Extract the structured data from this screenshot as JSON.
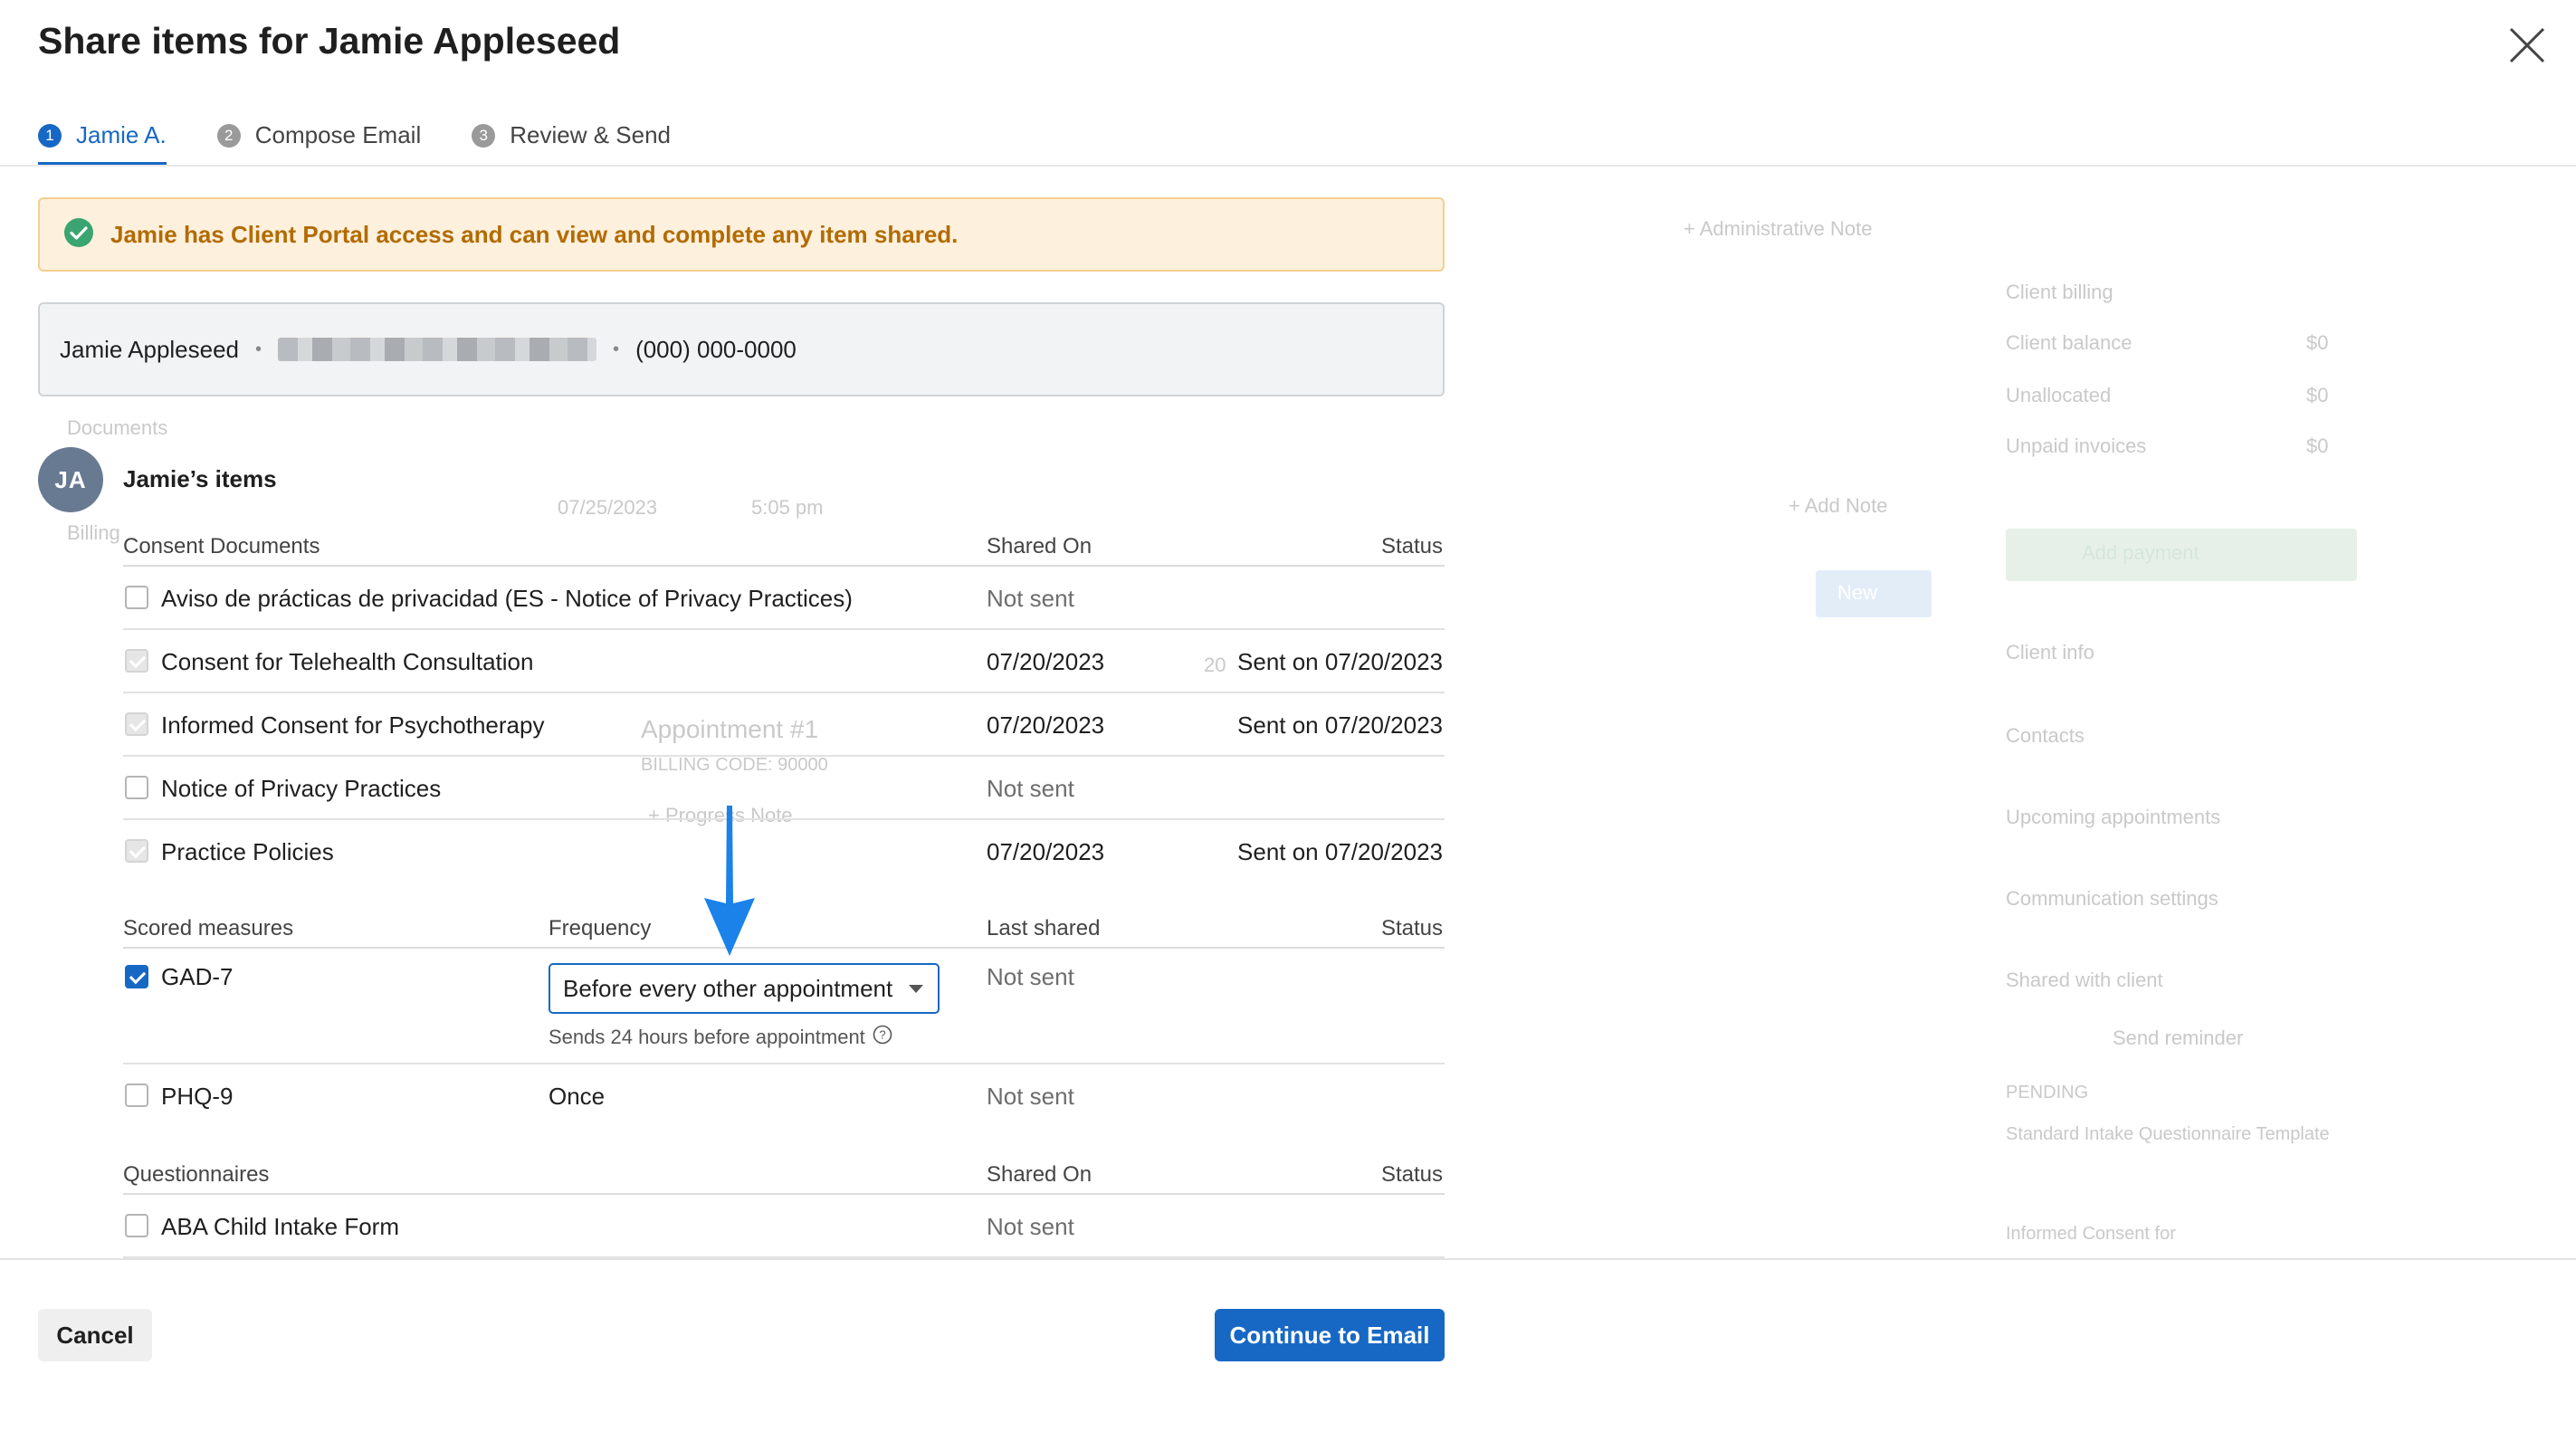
{
  "modal": {
    "title": "Share items for Jamie Appleseed",
    "close_icon": "close-icon"
  },
  "steps": [
    {
      "num": "1",
      "label": "Jamie A.",
      "active": true
    },
    {
      "num": "2",
      "label": "Compose Email",
      "active": false
    },
    {
      "num": "3",
      "label": "Review & Send",
      "active": false
    }
  ],
  "banner": {
    "icon": "check-circle-icon",
    "text": "Jamie has Client Portal access and can view and complete any item shared.",
    "colors": {
      "bg": "#fdf0dd",
      "text": "#b26b00",
      "icon": "#3aa570"
    }
  },
  "contact": {
    "name": "Jamie Appleseed",
    "phone": "(000) 000-0000",
    "separator": "•"
  },
  "client": {
    "initials": "JA",
    "items_title": "Jamie’s items"
  },
  "consent": {
    "header": {
      "name": "Consent Documents",
      "date": "Shared On",
      "status": "Status"
    },
    "rows": [
      {
        "name": "Aviso de prácticas de privacidad (ES - Notice of Privacy Practices)",
        "date": "Not sent",
        "status": ""
      },
      {
        "name": "Consent for Telehealth Consultation",
        "date": "07/20/2023",
        "status": "Sent on 07/20/2023"
      },
      {
        "name": "Informed Consent for Psychotherapy",
        "date": "07/20/2023",
        "status": "Sent on 07/20/2023"
      },
      {
        "name": "Notice of Privacy Practices",
        "date": "Not sent",
        "status": ""
      },
      {
        "name": "Practice Policies",
        "date": "07/20/2023",
        "status": "Sent on 07/20/2023"
      }
    ]
  },
  "scored": {
    "header": {
      "name": "Scored measures",
      "frequency": "Frequency",
      "date": "Last shared",
      "status": "Status"
    },
    "rows": [
      {
        "name": "GAD-7",
        "checked": true,
        "frequency": "Before every other appointment",
        "frequency_help": "Sends 24 hours before appointment",
        "help_icon": "question-circle-icon",
        "date": "Not sent",
        "status": ""
      },
      {
        "name": "PHQ-9",
        "checked": false,
        "frequency": "Once",
        "date": "Not sent",
        "status": ""
      }
    ]
  },
  "questionnaires": {
    "header": {
      "name": "Questionnaires",
      "date": "Shared On",
      "status": "Status"
    },
    "rows": [
      {
        "name": "ABA Child Intake Form",
        "date": "Not sent",
        "status": ""
      }
    ]
  },
  "footer": {
    "cancel": "Cancel",
    "continue": "Continue to Email"
  },
  "annotation": {
    "icon": "arrow-down-icon",
    "color": "#1a82e8"
  },
  "background": {
    "texts": [
      "+ Administrative Note",
      "Client billing",
      "Client balance",
      "$0",
      "Unallocated",
      "$0",
      "Unpaid invoices",
      "$0",
      "Documents",
      "Billing",
      "07/25/2023",
      "5:05 pm",
      "+ Add Note",
      "New",
      "20",
      "Appointment #1",
      "BILLING CODE: 90000",
      "+ Progress Note",
      "Client info",
      "Contacts",
      "Upcoming appointments",
      "Communication settings",
      "Shared with client",
      "PENDING",
      "Standard Intake Questionnaire Template",
      "Informed Consent for",
      "Send reminder",
      "Add payment"
    ]
  }
}
